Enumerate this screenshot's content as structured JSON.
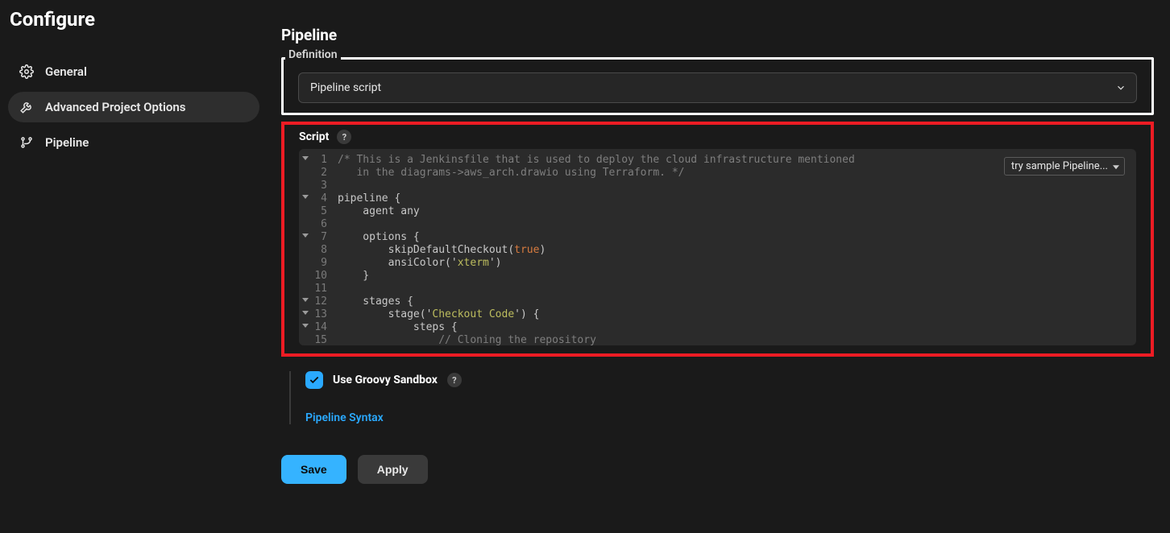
{
  "page_title": "Configure",
  "sidebar": {
    "items": [
      {
        "id": "general",
        "label": "General",
        "icon": "gear"
      },
      {
        "id": "advanced",
        "label": "Advanced Project Options",
        "icon": "wrench",
        "active": true
      },
      {
        "id": "pipeline",
        "label": "Pipeline",
        "icon": "branch"
      }
    ]
  },
  "section": {
    "heading": "Pipeline",
    "definition_label": "Definition",
    "definition_value": "Pipeline script"
  },
  "script": {
    "label": "Script",
    "help": "?",
    "sample_dropdown": "try sample Pipeline...",
    "lines": [
      "/* This is a Jenkinsfile that is used to deploy the cloud infrastructure mentioned",
      "   in the diagrams->aws_arch.drawio using Terraform. */",
      "",
      "pipeline {",
      "    agent any",
      "",
      "    options {",
      "        skipDefaultCheckout(true)",
      "        ansiColor('xterm')",
      "    }",
      "",
      "    stages {",
      "        stage('Checkout Code') {",
      "            steps {",
      "                // Cloning the repository"
    ],
    "fold_lines": [
      1,
      4,
      7,
      12,
      13,
      14
    ]
  },
  "sandbox": {
    "checked": true,
    "label": "Use Groovy Sandbox",
    "help": "?"
  },
  "pipeline_syntax_link": "Pipeline Syntax",
  "buttons": {
    "save": "Save",
    "apply": "Apply"
  },
  "chart_data": null
}
